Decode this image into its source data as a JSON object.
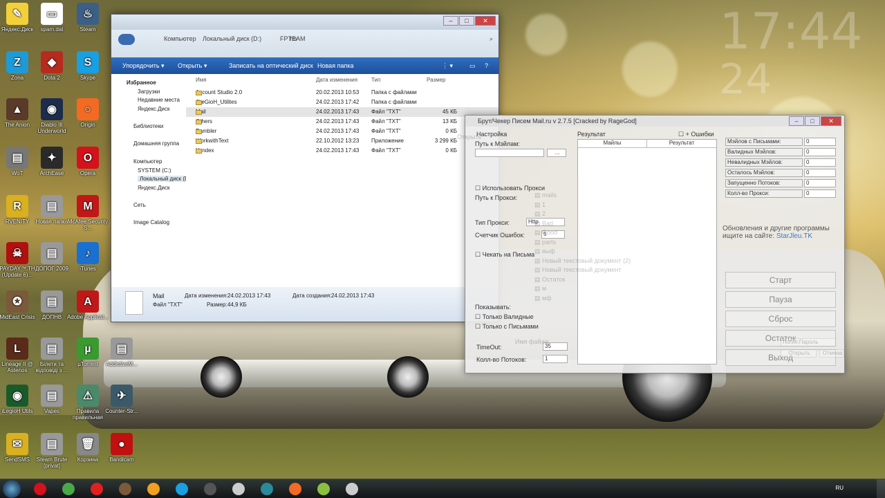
{
  "desktop": {
    "clock_time": "17:44",
    "clock_date": "24",
    "icons": [
      {
        "label": "Яндекс.Диск",
        "color": "#f3d03a",
        "glyph": "✎"
      },
      {
        "label": "spam.dat",
        "color": "#ffffff",
        "glyph": "▭"
      },
      {
        "label": "Steam",
        "color": "#3b5f86",
        "glyph": "♨"
      },
      {
        "label": "Zona",
        "color": "#1e9ad6",
        "glyph": "Z"
      },
      {
        "label": "Dota 2",
        "color": "#b72a1e",
        "glyph": "◆"
      },
      {
        "label": "Skype",
        "color": "#18a0e2",
        "glyph": "S"
      },
      {
        "label": "The Anion",
        "color": "#5a3a28",
        "glyph": "▲"
      },
      {
        "label": "Diablo III Underworld",
        "color": "#1d2c4a",
        "glyph": "◉"
      },
      {
        "label": "Origin",
        "color": "#f36a23",
        "glyph": "○"
      },
      {
        "label": "WoT",
        "color": "#777777",
        "glyph": "▤"
      },
      {
        "label": "ArchEase",
        "color": "#2a2a2a",
        "glyph": "✦"
      },
      {
        "label": "Opera",
        "color": "#d3121c",
        "glyph": "O"
      },
      {
        "label": "RVENITY",
        "color": "#d8b020",
        "glyph": "R"
      },
      {
        "label": "Новая папка",
        "color": "#999999",
        "glyph": "▤"
      },
      {
        "label": "McAfee Security S...",
        "color": "#c01818",
        "glyph": "M"
      },
      {
        "label": "PAYDAY™ TH (Update 6)...",
        "color": "#b01010",
        "glyph": "☠"
      },
      {
        "label": "ДОПОГ 2009",
        "color": "#999999",
        "glyph": "▤"
      },
      {
        "label": "iTunes",
        "color": "#1a70d0",
        "glyph": "♪"
      },
      {
        "label": "MidEast Crisis",
        "color": "#7a5a3a",
        "glyph": "✪"
      },
      {
        "label": "ДОПНВ",
        "color": "#999999",
        "glyph": "▤"
      },
      {
        "label": "Adobe Applicat...",
        "color": "#c01818",
        "glyph": "A"
      },
      {
        "label": "Lineage II @ Astenos",
        "color": "#5a2a1a",
        "glyph": "L"
      },
      {
        "label": "Білети та відповіді з ...",
        "color": "#999999",
        "glyph": "▤"
      },
      {
        "label": "µTorrent",
        "color": "#3a9a30",
        "glyph": "µ"
      },
      {
        "label": "AddictiveM...",
        "color": "#999999",
        "glyph": "▤"
      },
      {
        "label": "iLegioH Utils",
        "color": "#1a5a2a",
        "glyph": "◉"
      },
      {
        "label": "Vapes",
        "color": "#999999",
        "glyph": "▤"
      },
      {
        "label": "Правила правильная",
        "color": "#4a8a6a",
        "glyph": "⚠"
      },
      {
        "label": "Counter-Str...",
        "color": "#3a5a6a",
        "glyph": "✈"
      },
      {
        "label": "SendSMS",
        "color": "#d8b020",
        "glyph": "✉"
      },
      {
        "label": "Steam Brute [privat]",
        "color": "#999999",
        "glyph": "▤"
      },
      {
        "label": "Корзина",
        "color": "#888888",
        "glyph": "🗑"
      },
      {
        "label": "Bandicam",
        "color": "#c01010",
        "glyph": "●"
      }
    ]
  },
  "explorer": {
    "address": [
      "Компьютер",
      "Локальный диск (D:)",
      "FPTEAM",
      "hh"
    ],
    "toolbar": [
      "Упорядочить ▾",
      "Открыть ▾",
      "Записать на оптический диск",
      "Новая папка"
    ],
    "nav": [
      "Избранное",
      "Загрузки",
      "Недавние места",
      "Яндекс.Диск",
      "Библиотеки",
      "Домашняя группа",
      "Компьютер",
      "SYSTEM (C:)",
      "Локальный диск (D:)",
      "Яндекс.Диск",
      "Сеть",
      "Image Catalog"
    ],
    "columns": [
      "Имя",
      "Дата изменения",
      "Тип",
      "Размер"
    ],
    "files": [
      {
        "name": "Account Studio 2.0",
        "date": "20.02.2013 10:53",
        "type": "Папка с файлами",
        "size": ""
      },
      {
        "name": "JLeGioH_Utilites",
        "date": "24.02.2013 17:42",
        "type": "Папка с файлами",
        "size": ""
      },
      {
        "name": "Mail",
        "date": "24.02.2013 17:43",
        "type": "Файл \"TXT\"",
        "size": "45 КБ"
      },
      {
        "name": "Others",
        "date": "24.02.2013 17:43",
        "type": "Файл \"TXT\"",
        "size": "13 КБ"
      },
      {
        "name": "Rambler",
        "date": "24.02.2013 17:43",
        "type": "Файл \"TXT\"",
        "size": "0 КБ"
      },
      {
        "name": "WorkwithText",
        "date": "22.10.2012 13:23",
        "type": "Приложение",
        "size": "3 299 КБ"
      },
      {
        "name": "Yandex",
        "date": "24.02.2013 17:43",
        "type": "Файл \"TXT\"",
        "size": "0 КБ"
      }
    ],
    "details": {
      "name": "Mail",
      "type": "Файл \"TXT\"",
      "modified_label": "Дата изменения:",
      "modified": "24.02.2013 17:43",
      "created_label": "Дата создания:",
      "created": "24.02.2013 17:43",
      "size_label": "Размер:",
      "size": "44,9 КБ"
    }
  },
  "checker": {
    "title": "Брут/Чекер Писем Mail.ru v 2.7.5 [Cracked by RageGod]",
    "settings_label": "Настройка",
    "result_label": "Результат",
    "errors_label": "+ Ошибки",
    "path_label": "Путь к Мэйлам:",
    "browse": "...",
    "use_proxy": "Использовать Прокси",
    "proxy_path": "Путь к Прокси:",
    "proxy_type": "Тип Прокси:",
    "proxy_type_value": "Http",
    "error_counter": "Счетчик Ошибок:",
    "error_counter_value": "5",
    "check_letters": "Чекать на Письма",
    "show": "Показывать:",
    "only_valid": "Только Валидные",
    "only_letters": "Только с Письмами",
    "timeout_label": "TimeOut:",
    "timeout_value": "35",
    "threads_label": "Колл-во Потоков:",
    "threads_value": "1",
    "table_cols": [
      "Майлы",
      "Результат"
    ],
    "stats": [
      {
        "label": "Мэйлов с Письмами:",
        "value": "0"
      },
      {
        "label": "Валидных Мэйлов:",
        "value": "0"
      },
      {
        "label": "Невалидных Мэйлов:",
        "value": "0"
      },
      {
        "label": "Осталось Мэйлов:",
        "value": "0"
      },
      {
        "label": "Запущенно Потоков:",
        "value": "0"
      },
      {
        "label": "Колл-во Прокси:",
        "value": "0"
      }
    ],
    "promo": "Обновления и другие программы ищите на сайте:",
    "promo_link": "StarJleu.TK",
    "buttons": [
      "Старт",
      "Пауза",
      "Сброс",
      "Остаток",
      "Выход"
    ],
    "open_dialog": {
      "title": "Открыть",
      "folders": [
        "mails",
        "1",
        "2",
        "Bad",
        "Good",
        "parts",
        "выф",
        "Новый текстовый документ (2)",
        "Новый текстовый документ",
        "Остаток",
        "м",
        "мф"
      ],
      "filename_label": "Имя файла:",
      "filter": "Логин:Пароль",
      "open_btn": "Открыть",
      "cancel_btn": "Отмена"
    }
  },
  "taskbar": {
    "lang": "RU",
    "apps": [
      {
        "name": "opera-icon",
        "color": "#d3121c"
      },
      {
        "name": "chrome-icon",
        "color": "#4aa84a"
      },
      {
        "name": "yandex-icon",
        "color": "#e02020"
      },
      {
        "name": "game-icon",
        "color": "#7a5a3a"
      },
      {
        "name": "mail-agent-icon",
        "color": "#f0a020"
      },
      {
        "name": "skype-icon",
        "color": "#18a0e2"
      },
      {
        "name": "wot-icon",
        "color": "#555555"
      },
      {
        "name": "steam-brute-icon",
        "color": "#cccccc"
      },
      {
        "name": "app-icon",
        "color": "#2a8a9a"
      },
      {
        "name": "origin-icon",
        "color": "#f36a23"
      },
      {
        "name": "notepad-icon",
        "color": "#8ac040"
      },
      {
        "name": "explorer-icon",
        "color": "#cccccc"
      }
    ]
  }
}
